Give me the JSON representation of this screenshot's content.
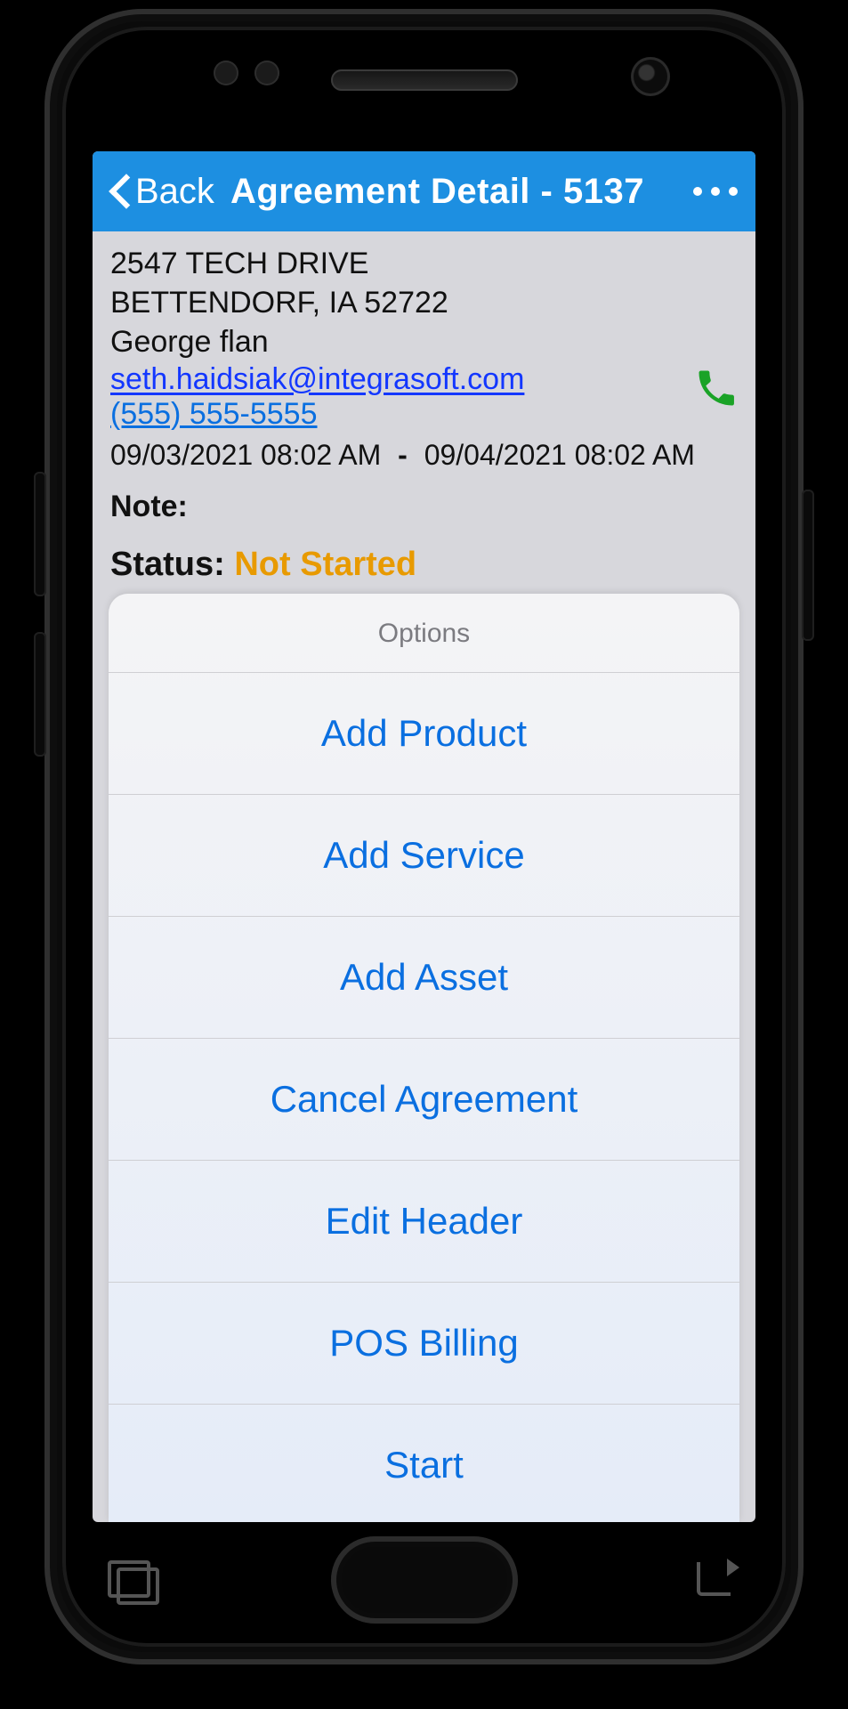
{
  "titlebar": {
    "back_label": "Back",
    "title": "Agreement Detail - 5137"
  },
  "detail": {
    "address_line1": "2547 TECH DRIVE",
    "address_line2": "BETTENDORF, IA 52722",
    "contact_name": "George flan",
    "email": "seth.haidsiak@integrasoft.com",
    "phone": "(555) 555-5555",
    "date_start": "09/03/2021 08:02 AM",
    "date_end": "09/04/2021 08:02 AM",
    "note_label": "Note:",
    "status_label": "Status:",
    "status_value": "Not Started"
  },
  "sheet": {
    "title": "Options",
    "items": [
      "Add Product",
      "Add Service",
      "Add Asset",
      "Cancel Agreement",
      "Edit Header",
      "POS Billing",
      "Start"
    ]
  }
}
